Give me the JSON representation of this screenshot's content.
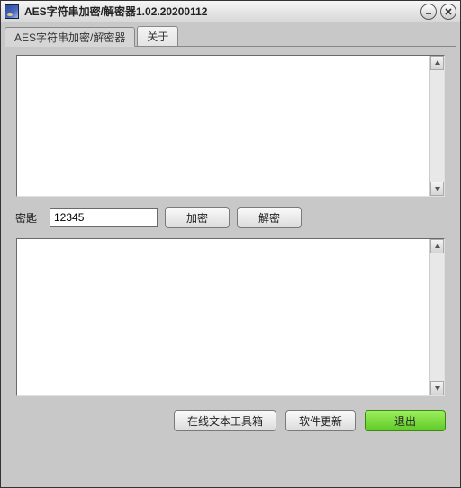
{
  "window": {
    "title": "AES字符串加密/解密器1.02.20200112"
  },
  "tabs": [
    {
      "label": "AES字符串加密/解密器",
      "active": true
    },
    {
      "label": "关于",
      "active": false
    }
  ],
  "inputArea": {
    "value": ""
  },
  "keyRow": {
    "label": "密匙",
    "value": "12345",
    "encryptLabel": "加密",
    "decryptLabel": "解密"
  },
  "outputArea": {
    "value": ""
  },
  "footer": {
    "toolboxLabel": "在线文本工具箱",
    "updateLabel": "软件更新",
    "exitLabel": "退出"
  },
  "colors": {
    "windowBg": "#c8c8c8",
    "exitButton": "#5fcb28"
  }
}
